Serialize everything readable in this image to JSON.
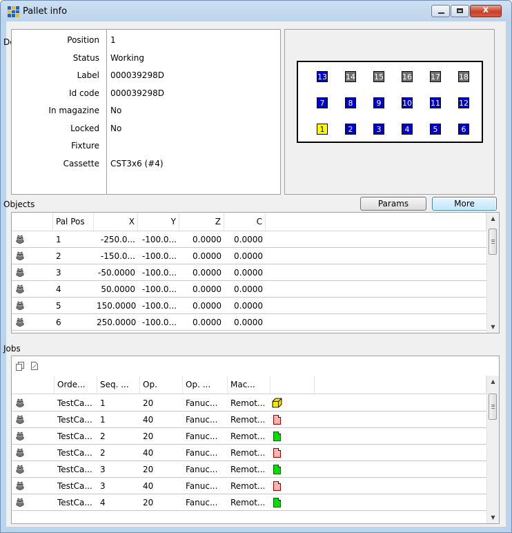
{
  "window": {
    "title": "Pallet info",
    "buttons": {
      "minimize": "minimize",
      "maximize": "maximize",
      "close": "close"
    },
    "close_glyph": "x"
  },
  "details": {
    "section_label": "Details",
    "rows": [
      {
        "label": "Position",
        "value": "1"
      },
      {
        "label": "Status",
        "value": "Working"
      },
      {
        "label": "Label",
        "value": "000039298D"
      },
      {
        "label": "Id code",
        "value": "000039298D"
      },
      {
        "label": "In magazine",
        "value": "No"
      },
      {
        "label": "Locked",
        "value": "No"
      },
      {
        "label": "Fixture",
        "value": ""
      },
      {
        "label": "Cassette",
        "value": "CST3x6 (#4)"
      }
    ]
  },
  "pallet_grid": {
    "rows": [
      [
        {
          "n": "13",
          "state": "blue"
        },
        {
          "n": "14",
          "state": "gray"
        },
        {
          "n": "15",
          "state": "gray"
        },
        {
          "n": "16",
          "state": "gray"
        },
        {
          "n": "17",
          "state": "gray"
        },
        {
          "n": "18",
          "state": "gray"
        }
      ],
      [
        {
          "n": "7",
          "state": "blue"
        },
        {
          "n": "8",
          "state": "blue"
        },
        {
          "n": "9",
          "state": "blue"
        },
        {
          "n": "10",
          "state": "blue"
        },
        {
          "n": "11",
          "state": "blue"
        },
        {
          "n": "12",
          "state": "blue"
        }
      ],
      [
        {
          "n": "1",
          "state": "yellow"
        },
        {
          "n": "2",
          "state": "blue"
        },
        {
          "n": "3",
          "state": "blue"
        },
        {
          "n": "4",
          "state": "blue"
        },
        {
          "n": "5",
          "state": "blue"
        },
        {
          "n": "6",
          "state": "blue"
        }
      ]
    ],
    "colors": {
      "blue": "#0000cc",
      "gray": "#6e6e6e",
      "yellow": "#ffff00"
    }
  },
  "objects": {
    "section_label": "Objects",
    "params_label": "Params",
    "more_label": "More",
    "columns": [
      "",
      "Pal Pos",
      "X",
      "Y",
      "Z",
      "C"
    ],
    "rows": [
      {
        "icon": "workpiece-icon",
        "pal_pos": "1",
        "x": "-250.0...",
        "y": "-100.0...",
        "z": "0.0000",
        "c": "0.0000"
      },
      {
        "icon": "workpiece-icon",
        "pal_pos": "2",
        "x": "-150.0...",
        "y": "-100.0...",
        "z": "0.0000",
        "c": "0.0000"
      },
      {
        "icon": "workpiece-icon",
        "pal_pos": "3",
        "x": "-50.0000",
        "y": "-100.0...",
        "z": "0.0000",
        "c": "0.0000"
      },
      {
        "icon": "workpiece-icon",
        "pal_pos": "4",
        "x": "50.0000",
        "y": "-100.0...",
        "z": "0.0000",
        "c": "0.0000"
      },
      {
        "icon": "workpiece-icon",
        "pal_pos": "5",
        "x": "150.0000",
        "y": "-100.0...",
        "z": "0.0000",
        "c": "0.0000"
      },
      {
        "icon": "workpiece-icon",
        "pal_pos": "6",
        "x": "250.0000",
        "y": "-100.0...",
        "z": "0.0000",
        "c": "0.0000"
      }
    ]
  },
  "jobs": {
    "section_label": "Jobs",
    "toolbar_icons": [
      "copy-icon",
      "document-icon"
    ],
    "columns": [
      "",
      "Orde...",
      "Seq. ...",
      "Op.",
      "Op. ...",
      "Mac...",
      ""
    ],
    "rows": [
      {
        "order": "TestCa...",
        "seq": "1",
        "op": "20",
        "op_desc": "Fanuc...",
        "machine": "Remot...",
        "status": "box-yellow-icon"
      },
      {
        "order": "TestCa...",
        "seq": "1",
        "op": "40",
        "op_desc": "Fanuc...",
        "machine": "Remot...",
        "status": "doc-red-icon"
      },
      {
        "order": "TestCa...",
        "seq": "2",
        "op": "20",
        "op_desc": "Fanuc...",
        "machine": "Remot...",
        "status": "doc-green-icon"
      },
      {
        "order": "TestCa...",
        "seq": "2",
        "op": "40",
        "op_desc": "Fanuc...",
        "machine": "Remot...",
        "status": "doc-red-icon"
      },
      {
        "order": "TestCa...",
        "seq": "3",
        "op": "20",
        "op_desc": "Fanuc...",
        "machine": "Remot...",
        "status": "doc-green-icon"
      },
      {
        "order": "TestCa...",
        "seq": "3",
        "op": "40",
        "op_desc": "Fanuc...",
        "machine": "Remot...",
        "status": "doc-red-icon"
      },
      {
        "order": "TestCa...",
        "seq": "4",
        "op": "20",
        "op_desc": "Fanuc...",
        "machine": "Remot...",
        "status": "doc-green-icon"
      }
    ]
  }
}
